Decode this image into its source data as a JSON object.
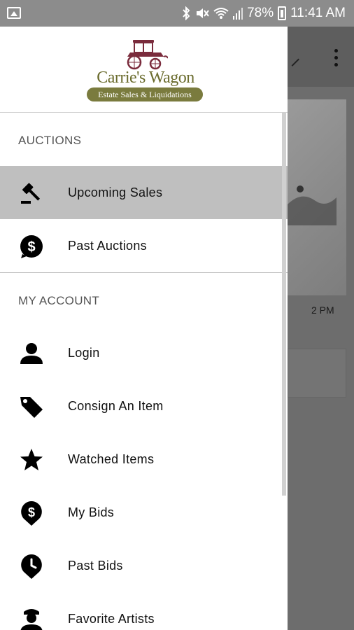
{
  "status_bar": {
    "battery_percent": "78%",
    "time": "11:41 AM"
  },
  "drawer": {
    "logo": {
      "name": "Carrie's Wagon",
      "tagline": "Estate Sales & Liquidations"
    },
    "sections": [
      {
        "header": "AUCTIONS",
        "items": [
          {
            "label": "Upcoming Sales",
            "icon": "gavel-icon",
            "active": true
          },
          {
            "label": "Past Auctions",
            "icon": "dollar-icon",
            "active": false
          }
        ]
      },
      {
        "header": "MY ACCOUNT",
        "items": [
          {
            "label": "Login",
            "icon": "person-icon",
            "active": false
          },
          {
            "label": "Consign An Item",
            "icon": "tag-icon",
            "active": false
          },
          {
            "label": "Watched Items",
            "icon": "star-icon",
            "active": false
          },
          {
            "label": "My Bids",
            "icon": "dollar-pin-icon",
            "active": false
          },
          {
            "label": "Past Bids",
            "icon": "clock-pin-icon",
            "active": false
          },
          {
            "label": "Favorite Artists",
            "icon": "artist-icon",
            "active": false
          }
        ]
      }
    ]
  },
  "background": {
    "time_label": "2 PM"
  },
  "colors": {
    "active_row": "#bfbfbf",
    "logo_olive": "#7a7b3e",
    "logo_wagon": "#7a2b3c"
  }
}
